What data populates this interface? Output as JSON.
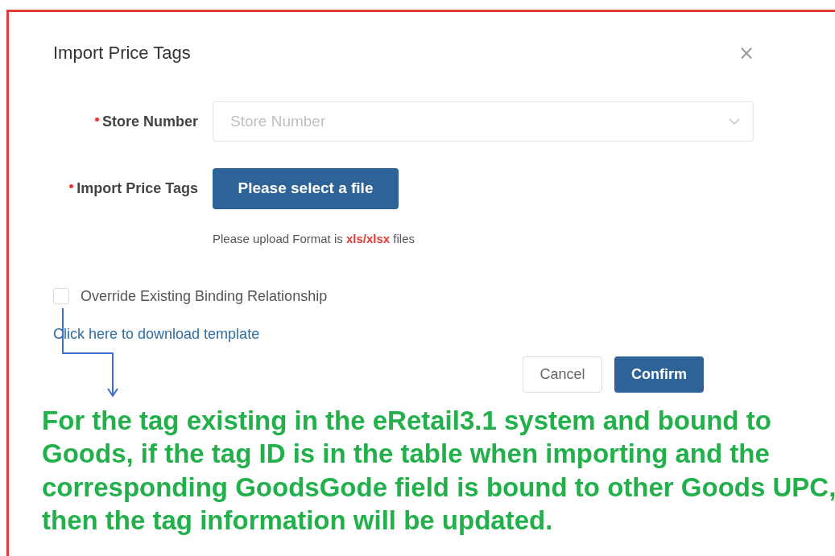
{
  "dialog": {
    "title": "Import Price Tags",
    "close": "×"
  },
  "fields": [
    {
      "kind": "select",
      "label": "Store Number",
      "required": true,
      "placeholder": "Store Number"
    },
    {
      "kind": "file",
      "label": "Import Price Tags",
      "required": true,
      "button": "Please select a file",
      "hint": "Please upload Format is **xls/xlsx** files"
    }
  ],
  "override": {
    "label": "Override Existing Binding Relationship",
    "checked": false
  },
  "template_link": "Click here to download template",
  "buttons": [
    {
      "kind": "secondary",
      "label": "Cancel"
    },
    {
      "kind": "primary",
      "label": "Confirm"
    }
  ],
  "annotation": "For the tag existing in the eRetail3.1 system and bound to Goods, if the tag ID is in the table when importing and the corresponding GoodsGode field is bound to other Goods UPC, then the tag information will be updated."
}
